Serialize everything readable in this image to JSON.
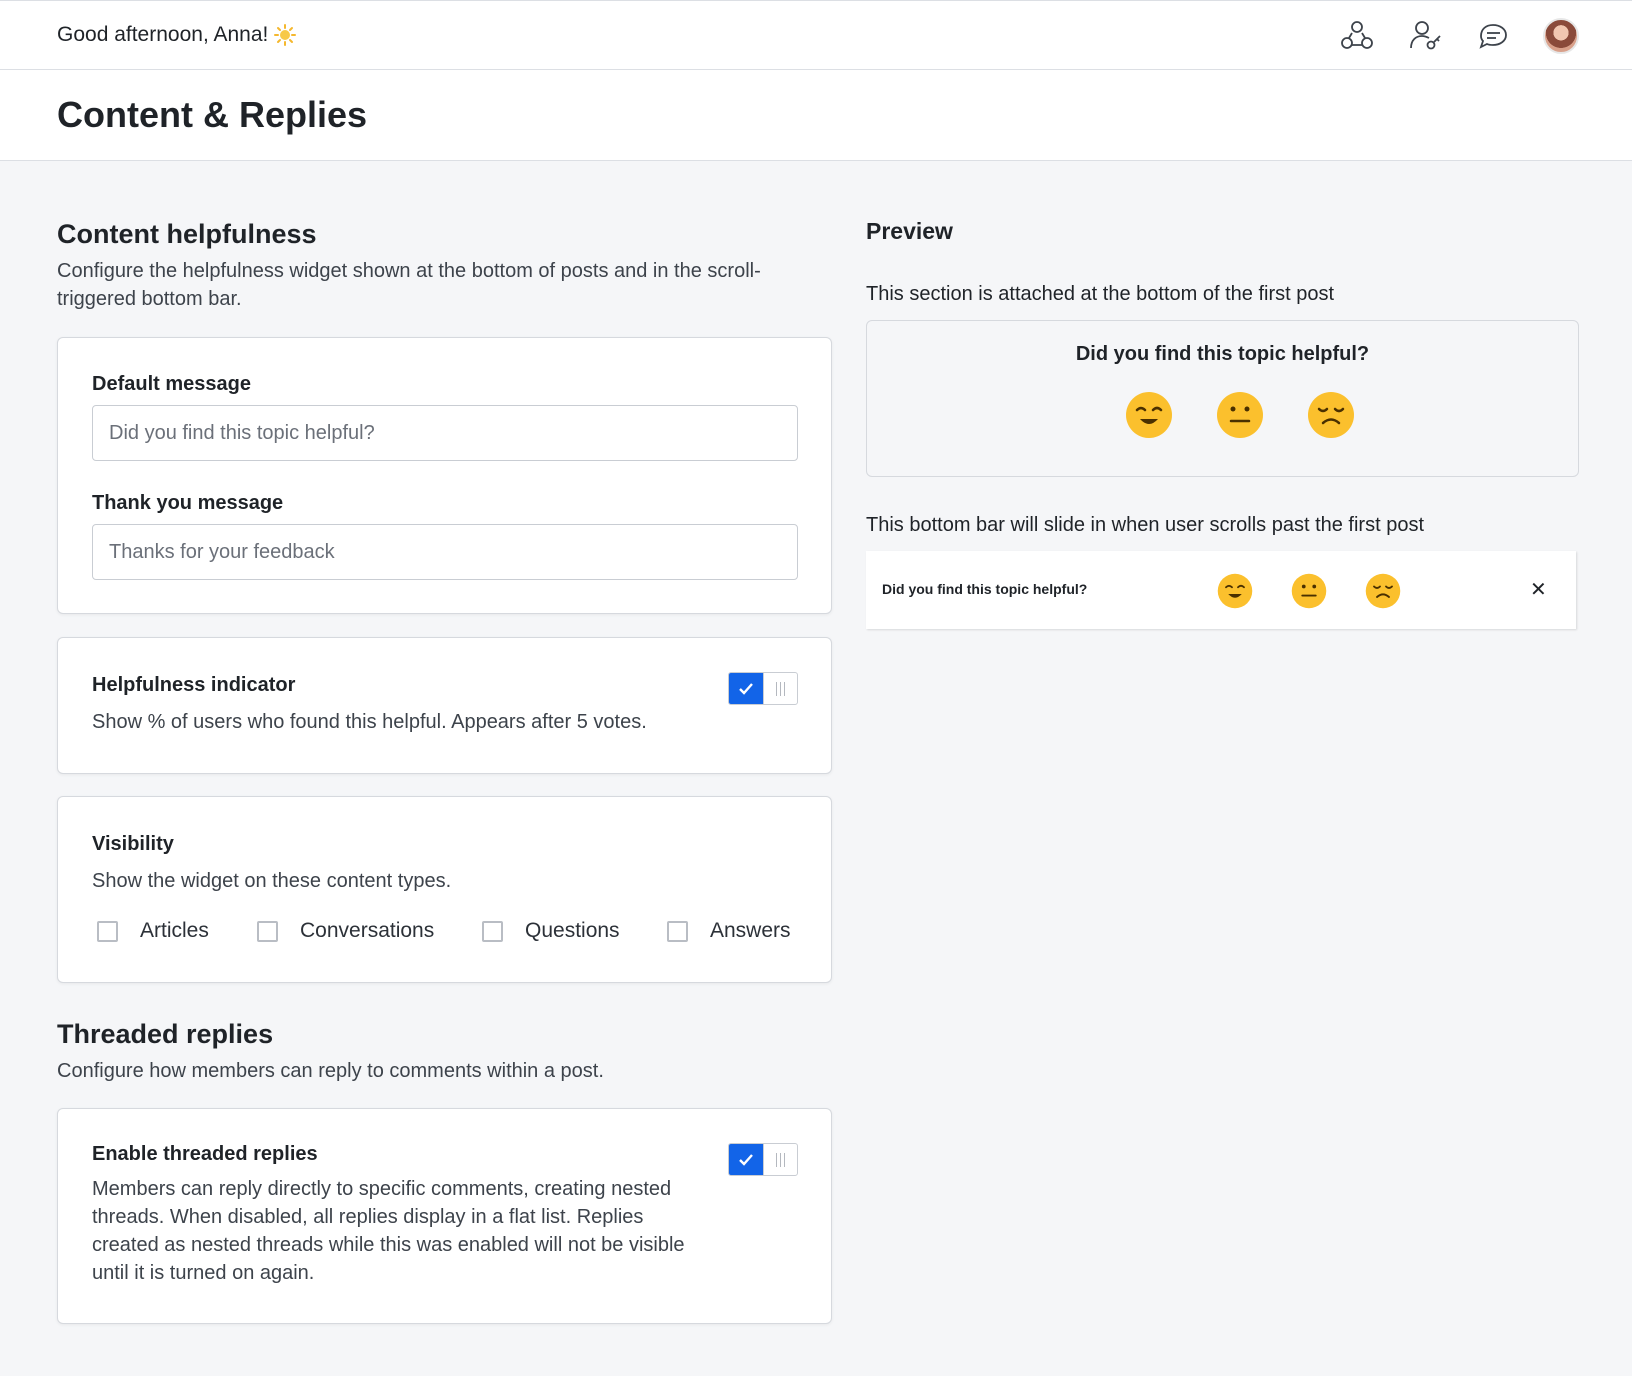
{
  "header": {
    "greeting": "Good afternoon, Anna!"
  },
  "page": {
    "title": "Content & Replies"
  },
  "content_helpfulness": {
    "title": "Content helpfulness",
    "description": "Configure the helpfulness widget shown at the bottom of posts and in the scroll-triggered bottom bar.",
    "default_message_label": "Default message",
    "default_message_placeholder": "Did you find this topic helpful?",
    "thank_you_label": "Thank you message",
    "thank_you_placeholder": "Thanks for your feedback"
  },
  "helpfulness_indicator": {
    "title": "Helpfulness indicator",
    "description": "Show % of users who found this helpful. Appears after 5 votes.",
    "enabled": true
  },
  "visibility": {
    "title": "Visibility",
    "description": "Show the widget on these content types.",
    "options": [
      {
        "label": "Articles",
        "checked": false
      },
      {
        "label": "Conversations",
        "checked": false
      },
      {
        "label": "Questions",
        "checked": false
      },
      {
        "label": "Answers",
        "checked": false
      }
    ]
  },
  "threaded_replies": {
    "title": "Threaded replies",
    "description": "Configure how members can reply to comments within a post.",
    "enable_title": "Enable threaded replies",
    "enable_description": "Members can reply directly to specific comments, creating nested threads. When disabled, all replies display in a flat list. Replies created as nested threads while this was enabled will not be visible until it is turned on again.",
    "enabled": true
  },
  "preview": {
    "title": "Preview",
    "attached_desc": "This section is attached at the bottom of the first post",
    "question": "Did you find this topic helpful?",
    "bottom_bar_desc": "This bottom bar will slide in when user scrolls past the first post",
    "bar_question": "Did you find this topic helpful?",
    "close_glyph": "✕"
  },
  "icons": {
    "sun": "sun-icon",
    "community": "community-icon",
    "user_key": "user-key-icon",
    "chat": "chat-icon",
    "check": "check-icon",
    "emoji_happy": "happy-face-icon",
    "emoji_neutral": "neutral-face-icon",
    "emoji_sad": "sad-face-icon"
  },
  "colors": {
    "accent": "#1264e8",
    "emoji": "#fbc02d",
    "background": "#f5f6f8"
  }
}
